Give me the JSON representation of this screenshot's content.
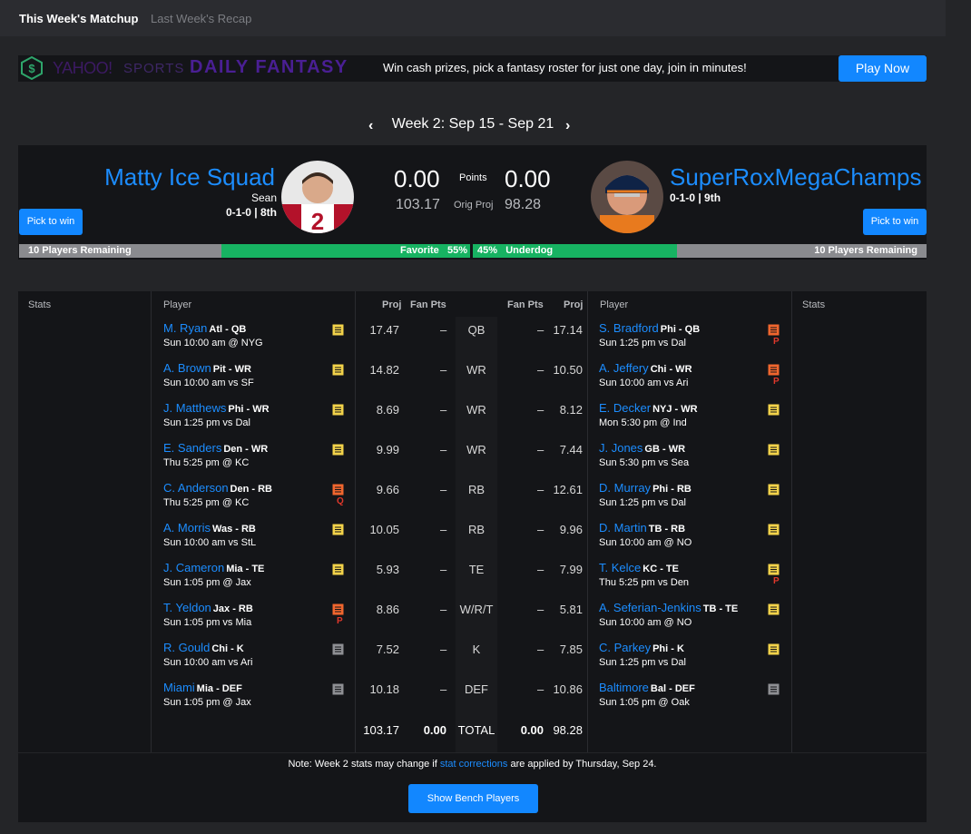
{
  "tabs": {
    "active": "This Week's Matchup",
    "inactive": "Last Week's Recap"
  },
  "promo": {
    "brand_yahoo": "YAHOO!",
    "brand_sports": "SPORTS",
    "brand_daily": "DAILY FANTASY",
    "text": "Win cash prizes, pick a fantasy roster for just one day, join in minutes!",
    "button": "Play Now"
  },
  "week": {
    "label": "Week 2: Sep 15 - Sep 21",
    "prev_icon": "chevron-left-icon",
    "next_icon": "chevron-right-icon"
  },
  "matchup": {
    "left": {
      "name": "Matty Ice Squad",
      "manager": "Sean",
      "record": "0-1-0 | 8th",
      "score": "0.00",
      "proj": "103.17",
      "pick": "Pick to win",
      "remaining": "10 Players Remaining",
      "label": "Favorite",
      "pct": "55%"
    },
    "right": {
      "name": "SuperRoxMegaChamps",
      "record": "0-1-0 | 9th",
      "score": "0.00",
      "proj": "98.28",
      "pick": "Pick to win",
      "remaining": "10 Players Remaining",
      "label": "Underdog",
      "pct": "45%"
    },
    "points_label": "Points",
    "orig_proj_label": "Orig Proj",
    "win_probability": {
      "left": 0.55,
      "right": 0.45
    },
    "colors": {
      "team_name": "#1c8dff",
      "bar_fill": "#17b362",
      "button": "#1287ff"
    }
  },
  "headers": {
    "stats": "Stats",
    "player": "Player",
    "proj": "Proj",
    "fan_pts": "Fan Pts"
  },
  "rows": [
    {
      "pos": "QB",
      "l": {
        "name": "M. Ryan",
        "team": "Atl - QB",
        "game": "Sun 10:00 am @ NYG",
        "proj": "17.47",
        "pts": "–",
        "note": "yellow",
        "status": ""
      },
      "r": {
        "name": "S. Bradford",
        "team": "Phi - QB",
        "game": "Sun 1:25 pm vs Dal",
        "proj": "17.14",
        "pts": "–",
        "note": "orange",
        "status": "P"
      }
    },
    {
      "pos": "WR",
      "l": {
        "name": "A. Brown",
        "team": "Pit - WR",
        "game": "Sun 10:00 am vs SF",
        "proj": "14.82",
        "pts": "–",
        "note": "yellow",
        "status": ""
      },
      "r": {
        "name": "A. Jeffery",
        "team": "Chi - WR",
        "game": "Sun 10:00 am vs Ari",
        "proj": "10.50",
        "pts": "–",
        "note": "orange",
        "status": "P"
      }
    },
    {
      "pos": "WR",
      "l": {
        "name": "J. Matthews",
        "team": "Phi - WR",
        "game": "Sun 1:25 pm vs Dal",
        "proj": "8.69",
        "pts": "–",
        "note": "yellow",
        "status": ""
      },
      "r": {
        "name": "E. Decker",
        "team": "NYJ - WR",
        "game": "Mon 5:30 pm @ Ind",
        "proj": "8.12",
        "pts": "–",
        "note": "yellow",
        "status": ""
      }
    },
    {
      "pos": "WR",
      "l": {
        "name": "E. Sanders",
        "team": "Den - WR",
        "game": "Thu 5:25 pm @ KC",
        "proj": "9.99",
        "pts": "–",
        "note": "yellow",
        "status": ""
      },
      "r": {
        "name": "J. Jones",
        "team": "GB - WR",
        "game": "Sun 5:30 pm vs Sea",
        "proj": "7.44",
        "pts": "–",
        "note": "yellow",
        "status": ""
      }
    },
    {
      "pos": "RB",
      "l": {
        "name": "C. Anderson",
        "team": "Den - RB",
        "game": "Thu 5:25 pm @ KC",
        "proj": "9.66",
        "pts": "–",
        "note": "orange",
        "status": "Q"
      },
      "r": {
        "name": "D. Murray",
        "team": "Phi - RB",
        "game": "Sun 1:25 pm vs Dal",
        "proj": "12.61",
        "pts": "–",
        "note": "yellow",
        "status": ""
      }
    },
    {
      "pos": "RB",
      "l": {
        "name": "A. Morris",
        "team": "Was - RB",
        "game": "Sun 10:00 am vs StL",
        "proj": "10.05",
        "pts": "–",
        "note": "yellow",
        "status": ""
      },
      "r": {
        "name": "D. Martin",
        "team": "TB - RB",
        "game": "Sun 10:00 am @ NO",
        "proj": "9.96",
        "pts": "–",
        "note": "yellow",
        "status": ""
      }
    },
    {
      "pos": "TE",
      "l": {
        "name": "J. Cameron",
        "team": "Mia - TE",
        "game": "Sun 1:05 pm @ Jax",
        "proj": "5.93",
        "pts": "–",
        "note": "yellow",
        "status": ""
      },
      "r": {
        "name": "T. Kelce",
        "team": "KC - TE",
        "game": "Thu 5:25 pm vs Den",
        "proj": "7.99",
        "pts": "–",
        "note": "yellow",
        "status": "P"
      }
    },
    {
      "pos": "W/R/T",
      "l": {
        "name": "T. Yeldon",
        "team": "Jax - RB",
        "game": "Sun 1:05 pm vs Mia",
        "proj": "8.86",
        "pts": "–",
        "note": "orange",
        "status": "P"
      },
      "r": {
        "name": "A. Seferian-Jenkins",
        "team": "TB - TE",
        "game": "Sun 10:00 am @ NO",
        "proj": "5.81",
        "pts": "–",
        "note": "yellow",
        "status": ""
      }
    },
    {
      "pos": "K",
      "l": {
        "name": "R. Gould",
        "team": "Chi - K",
        "game": "Sun 10:00 am vs Ari",
        "proj": "7.52",
        "pts": "–",
        "note": "gray",
        "status": ""
      },
      "r": {
        "name": "C. Parkey",
        "team": "Phi - K",
        "game": "Sun 1:25 pm vs Dal",
        "proj": "7.85",
        "pts": "–",
        "note": "yellow",
        "status": ""
      }
    },
    {
      "pos": "DEF",
      "l": {
        "name": "Miami",
        "team": "Mia - DEF",
        "game": "Sun 1:05 pm @ Jax",
        "proj": "10.18",
        "pts": "–",
        "note": "gray",
        "status": ""
      },
      "r": {
        "name": "Baltimore",
        "team": "Bal - DEF",
        "game": "Sun 1:05 pm @ Oak",
        "proj": "10.86",
        "pts": "–",
        "note": "gray",
        "status": ""
      }
    }
  ],
  "totals": {
    "label": "TOTAL",
    "l_proj": "103.17",
    "l_pts": "0.00",
    "r_pts": "0.00",
    "r_proj": "98.28"
  },
  "note_colors": {
    "yellow": "#f2d24a",
    "orange": "#f0662e",
    "gray": "#8e8f93"
  },
  "footer": {
    "note_before": "Note: Week 2 stats may change if ",
    "note_link": "stat corrections",
    "note_after": " are applied by Thursday, Sep 24.",
    "bench_button": "Show Bench Players"
  }
}
